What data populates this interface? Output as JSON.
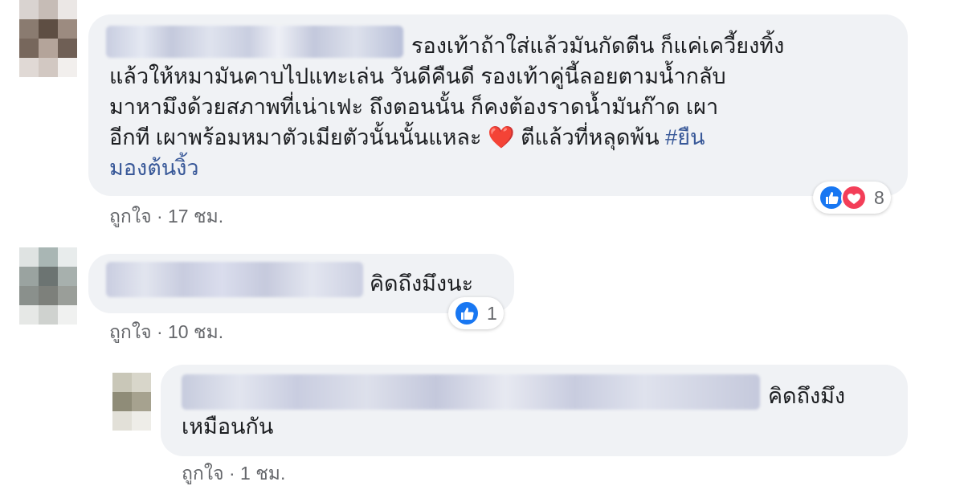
{
  "comments": [
    {
      "text_line1": "รองเท้าถ้าใส่แล้วมันกัดตีน ก็แค่เควี้ยงทิ้ง",
      "text_rest_a": "แล้วให้หมามันคาบไปแทะเล่น วันดีคืนดี รองเท้าคู่นี้ลอยตามน้ำกลับ\nมาหามึงด้วยสภาพที่เน่าเฟะ ถึงตอนนั้น ก็คงต้องราดน้ำมันก๊าด เผา\nอีกที เผาพร้อมหมาตัวเมียตัวนั้นนั้นแหละ ",
      "heart_emoji": "❤️",
      "text_rest_b": " ตีแล้วที่หลุดพ้น ",
      "hashtag": "#ยืน\nมองต้นงิ้ว",
      "like_label": "ถูกใจ",
      "separator": "·",
      "time": "17 ชม.",
      "reaction_count": "8",
      "reaction_icons": [
        "like-icon",
        "love-icon"
      ]
    },
    {
      "text": "คิดถึงมึงนะ",
      "like_label": "ถูกใจ",
      "separator": "·",
      "time": "10 ชม.",
      "reaction_count": "1",
      "reaction_icons": [
        "like-icon"
      ]
    },
    {
      "text_line1": "คิดถึงมึง",
      "text_line2": "เหมือนกัน",
      "like_label": "ถูกใจ",
      "separator": "·",
      "time": "1 ชม."
    }
  ],
  "colors": {
    "bubble": "#f0f2f5",
    "text": "#1c1e21",
    "meta": "#65676b",
    "hashtag": "#385898",
    "like_blue": "#1877f2",
    "love_red": "#f33e58"
  }
}
